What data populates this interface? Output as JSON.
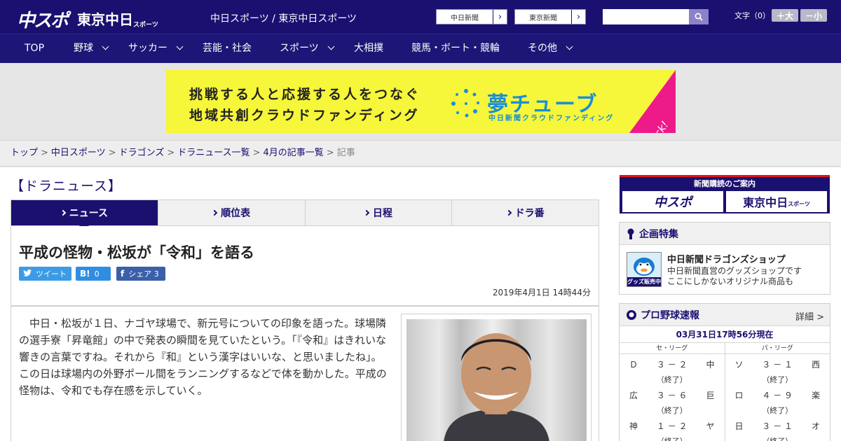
{
  "header": {
    "logo_chunichi": "中スポ",
    "logo_tokyo": "東京中日",
    "logo_tokyo_sub": "スポーツ",
    "site_names": "中日スポーツ / 東京中日スポーツ",
    "ext_links": [
      {
        "label": "中日新聞",
        "arrow": "›"
      },
      {
        "label": "東京新聞",
        "arrow": "›"
      }
    ],
    "search_placeholder": "",
    "font_size_label": "文字（0）",
    "font_larger": "＋大",
    "font_smaller": "－小"
  },
  "nav": {
    "items": [
      {
        "label": "TOP",
        "has_menu": false
      },
      {
        "label": "野球",
        "has_menu": true
      },
      {
        "label": "サッカー",
        "has_menu": true
      },
      {
        "label": "芸能・社会",
        "has_menu": false
      },
      {
        "label": "スポーツ",
        "has_menu": true
      },
      {
        "label": "大相撲",
        "has_menu": false
      },
      {
        "label": "競馬・ボート・競輪",
        "has_menu": false
      },
      {
        "label": "その他",
        "has_menu": true
      }
    ]
  },
  "banner": {
    "line1": "挑戦する人と応援する人をつなぐ",
    "line2": "地域共創クラウドファンディング",
    "title": "夢チューブ",
    "subtitle": "中日新聞クラウドファンディング",
    "click": "Click!",
    "bg_color": "#f6f63a",
    "accent_color": "#1a8ed8",
    "click_color": "#ee1a8a"
  },
  "breadcrumb": {
    "items": [
      "トップ",
      "中日スポーツ",
      "ドラゴンズ",
      "ドラニュース一覧",
      "4月の記事一覧"
    ],
    "separator": ">",
    "current": "記事"
  },
  "section_title": "【ドラニュース】",
  "tabs": [
    {
      "label": "ニュース",
      "active": true
    },
    {
      "label": "順位表",
      "active": false
    },
    {
      "label": "日程",
      "active": false
    },
    {
      "label": "ドラ番",
      "active": false
    }
  ],
  "article": {
    "title": "平成の怪物・松坂が「令和」を語る",
    "share": {
      "tweet_icon": "🐦",
      "tweet_label": "ツイート",
      "hatena_icon": "B!",
      "hatena_count": "0",
      "facebook_icon": "f",
      "facebook_label": "シェア",
      "facebook_count": "3"
    },
    "date": "2019年4月1日 14時44分",
    "body": "中日・松坂が１日、ナゴヤ球場で、新元号についての印象を語った。球場隣の選手寮「昇竜館」の中で発表の瞬間を見ていたという。「『令和』はきれいな響きの言葉ですね。それから『和』という漢字はいいな、と思いましたね」。この日は球場内の外野ポール間をランニングするなどで体を動かした。平成の怪物は、令和でも存在感を示していく。"
  },
  "sidebar": {
    "subscribe_label": "新聞購読のご案内",
    "subscribe_logo1": "中スポ",
    "subscribe_logo2": "東京中日",
    "subscribe_logo2_sub": "スポーツ",
    "feature": {
      "heading": "企画特集",
      "thumb_label": "グッズ販売中",
      "title": "中日新聞ドラゴンズショップ",
      "desc_line1": "中日新聞直営のグッズショップです",
      "desc_line2": "ここにしかないオリジナル商品も"
    },
    "scores": {
      "heading": "プロ野球速報",
      "more": "詳細 >",
      "time": "03月31日17時56分現在",
      "central_label": "セ・リーグ",
      "pacific_label": "パ・リーグ",
      "central": [
        {
          "home": "Ｄ",
          "score": "３ － ２",
          "away": "中",
          "status": "（終了）"
        },
        {
          "home": "広",
          "score": "３ － ６",
          "away": "巨",
          "status": "（終了）"
        },
        {
          "home": "神",
          "score": "１ － ２",
          "away": "ヤ",
          "status": "（終了）"
        }
      ],
      "pacific": [
        {
          "home": "ソ",
          "score": "３ － １",
          "away": "西",
          "status": "（終了）"
        },
        {
          "home": "ロ",
          "score": "４ － ９",
          "away": "楽",
          "status": "（終了）"
        },
        {
          "home": "日",
          "score": "３ － １",
          "away": "オ",
          "status": "（終了）"
        }
      ]
    }
  }
}
